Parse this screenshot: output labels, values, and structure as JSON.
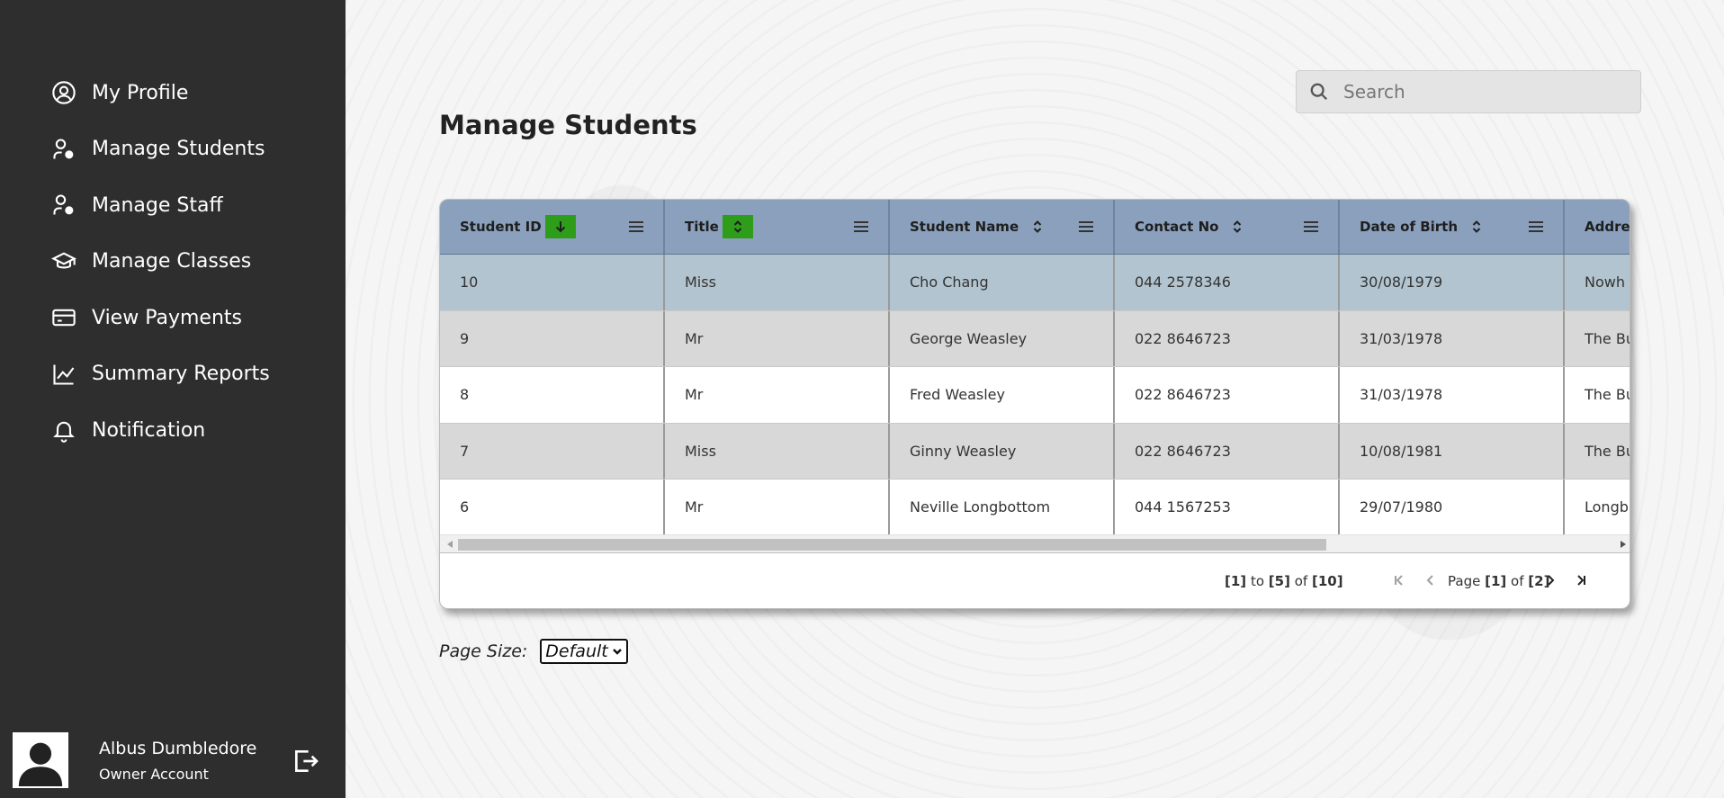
{
  "sidebar": {
    "items": [
      {
        "label": "My Profile",
        "icon": "user-circle-icon"
      },
      {
        "label": "Manage Students",
        "icon": "user-settings-icon"
      },
      {
        "label": "Manage Staff",
        "icon": "user-settings-icon"
      },
      {
        "label": "Manage Classes",
        "icon": "graduation-cap-icon"
      },
      {
        "label": "View Payments",
        "icon": "credit-card-icon"
      },
      {
        "label": "Summary Reports",
        "icon": "line-chart-icon"
      },
      {
        "label": "Notification",
        "icon": "bell-icon"
      }
    ],
    "user": {
      "name": "Albus Dumbledore",
      "role": "Owner Account"
    }
  },
  "main": {
    "title": "Manage Students",
    "search": {
      "placeholder": "Search"
    },
    "table": {
      "columns": [
        "Student ID",
        "Title",
        "Student Name",
        "Contact No",
        "Date of Birth",
        "Addre"
      ],
      "rows": [
        [
          "10",
          "Miss",
          "Cho Chang",
          "044 2578346",
          "30/08/1979",
          "Nowh"
        ],
        [
          "9",
          "Mr",
          "George Weasley",
          "022 8646723",
          "31/03/1978",
          "The Bu"
        ],
        [
          "8",
          "Mr",
          "Fred Weasley",
          "022 8646723",
          "31/03/1978",
          "The Bu"
        ],
        [
          "7",
          "Miss",
          "Ginny Weasley",
          "022 8646723",
          "10/08/1981",
          "The Bu"
        ],
        [
          "6",
          "Mr",
          "Neville Longbottom",
          "044 1567253",
          "29/07/1980",
          "Longb"
        ]
      ],
      "selected_row": 0
    },
    "pager": {
      "from": "[1]",
      "to_word": "to",
      "to": "[5]",
      "of_word": "of",
      "total": "[10]",
      "page_word": "Page",
      "page": "[1]",
      "page_of_word": "of",
      "pages": "[2]"
    },
    "page_size": {
      "label": "Page Size:",
      "value": "Default"
    }
  },
  "colors": {
    "sidebar_bg": "#2e2e2e",
    "header_bg": "#8aa0bc",
    "selected_row": "#b2c4cf",
    "sort_highlight": "#2e9e1a"
  }
}
